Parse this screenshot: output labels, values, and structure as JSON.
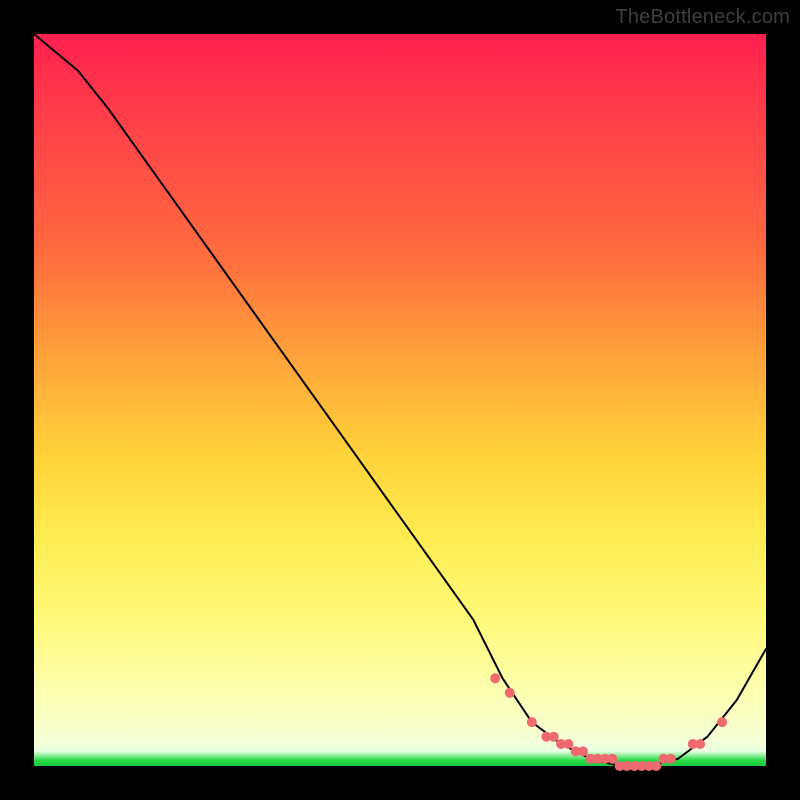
{
  "watermark": "TheBottleneck.com",
  "chart_data": {
    "type": "line",
    "title": "",
    "xlabel": "",
    "ylabel": "",
    "xlim": [
      0,
      100
    ],
    "ylim": [
      0,
      100
    ],
    "grid": false,
    "legend": false,
    "series": [
      {
        "name": "bottleneck-curve",
        "x": [
          0,
          6,
          10,
          20,
          30,
          40,
          50,
          60,
          64,
          68,
          72,
          76,
          80,
          84,
          88,
          92,
          96,
          100
        ],
        "values": [
          100,
          95,
          90,
          76,
          62,
          48,
          34,
          20,
          12,
          6,
          3,
          1,
          0,
          0,
          1,
          4,
          9,
          16
        ]
      }
    ],
    "markers": {
      "name": "bottom-dots",
      "color": "#ef6a6f",
      "x": [
        63,
        65,
        68,
        70,
        71,
        72,
        73,
        74,
        75,
        76,
        77,
        78,
        79,
        80,
        81,
        82,
        83,
        84,
        85,
        86,
        87,
        90,
        91,
        94
      ],
      "values": [
        12,
        10,
        6,
        4,
        4,
        3,
        3,
        2,
        2,
        1,
        1,
        1,
        1,
        0,
        0,
        0,
        0,
        0,
        0,
        1,
        1,
        3,
        3,
        6
      ]
    }
  }
}
